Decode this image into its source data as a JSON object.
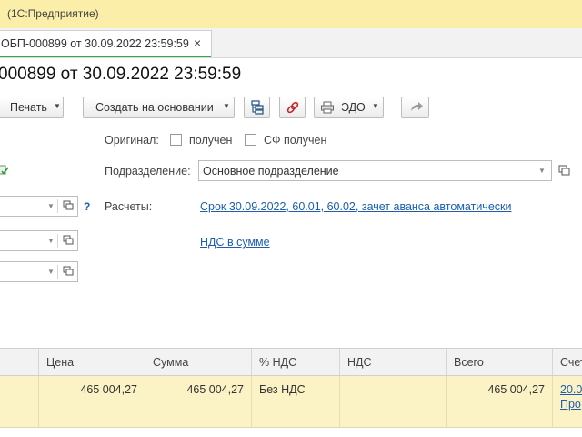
{
  "window": {
    "title": "(1С:Предприятие)"
  },
  "tab": {
    "label": "ОБП-000899 от 30.09.2022 23:59:59",
    "close_glyph": "×"
  },
  "document": {
    "title": "000899 от 30.09.2022 23:59:59"
  },
  "toolbar": {
    "print_label": "Печать",
    "create_based_label": "Создать на основании",
    "edo_label": "ЭДО",
    "icons": [
      "structure-icon",
      "link-icon",
      "printer-icon",
      "post-arrow-icon"
    ]
  },
  "form": {
    "original_label": "Оригинал:",
    "received_label": "получен",
    "sf_received_label": "СФ получен",
    "subdivision_label": "Подразделение:",
    "subdivision_value": "Основное подразделение",
    "settlements_label": "Расчеты:",
    "settlements_link": "Срок 30.09.2022, 60.01, 60.02, зачет аванса автоматически",
    "vat_link": "НДС в сумме",
    "help_glyph": "?"
  },
  "table": {
    "columns": [
      "Цена",
      "Сумма",
      "% НДС",
      "НДС",
      "Всего",
      "Счет"
    ],
    "rows": [
      {
        "price": "465 004,27",
        "sum": "465 004,27",
        "vat_rate": "Без НДС",
        "vat": "",
        "total": "465 004,27",
        "account": "20.0",
        "account2": "Про"
      }
    ]
  },
  "colors": {
    "titlebar": "#fbeea8",
    "row_selected": "#fbf2c6",
    "link": "#1d5fae",
    "tab_accent": "#3aa64a"
  }
}
